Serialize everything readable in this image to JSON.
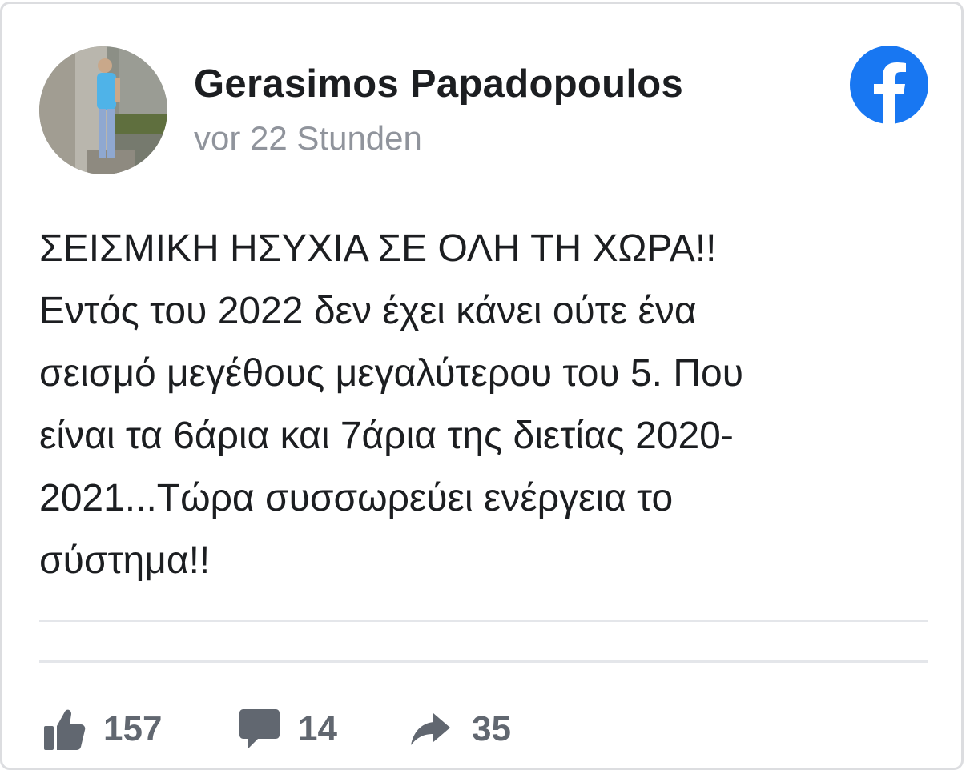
{
  "post": {
    "author_name": "Gerasimos Papadopoulos",
    "timestamp": "vor 22 Stunden",
    "text": "ΣΕΙΣΜΙΚΗ ΗΣΥΧΙΑ ΣΕ ΟΛΗ ΤΗ ΧΩΡΑ!!\nΕντός του 2022 δεν έχει κάνει ούτε ένα\nσεισμό μεγέθους μεγαλύτερου του 5. Που\nείναι τα 6άρια και 7άρια της διετίας 2020-\n2021...Τώρα συσσωρεύει ενέργεια το\nσύστημα!!"
  },
  "stats": {
    "likes": "157",
    "comments": "14",
    "shares": "35"
  },
  "icons": {
    "platform": "facebook-logo-icon",
    "like": "thumbs-up-icon",
    "comment": "speech-bubble-icon",
    "share": "share-arrow-icon"
  },
  "colors": {
    "brand": "#1877f2",
    "author_text": "#1c1e21",
    "muted_text": "#90949c",
    "action_gray": "#616770",
    "divider": "#e4e6ea"
  }
}
